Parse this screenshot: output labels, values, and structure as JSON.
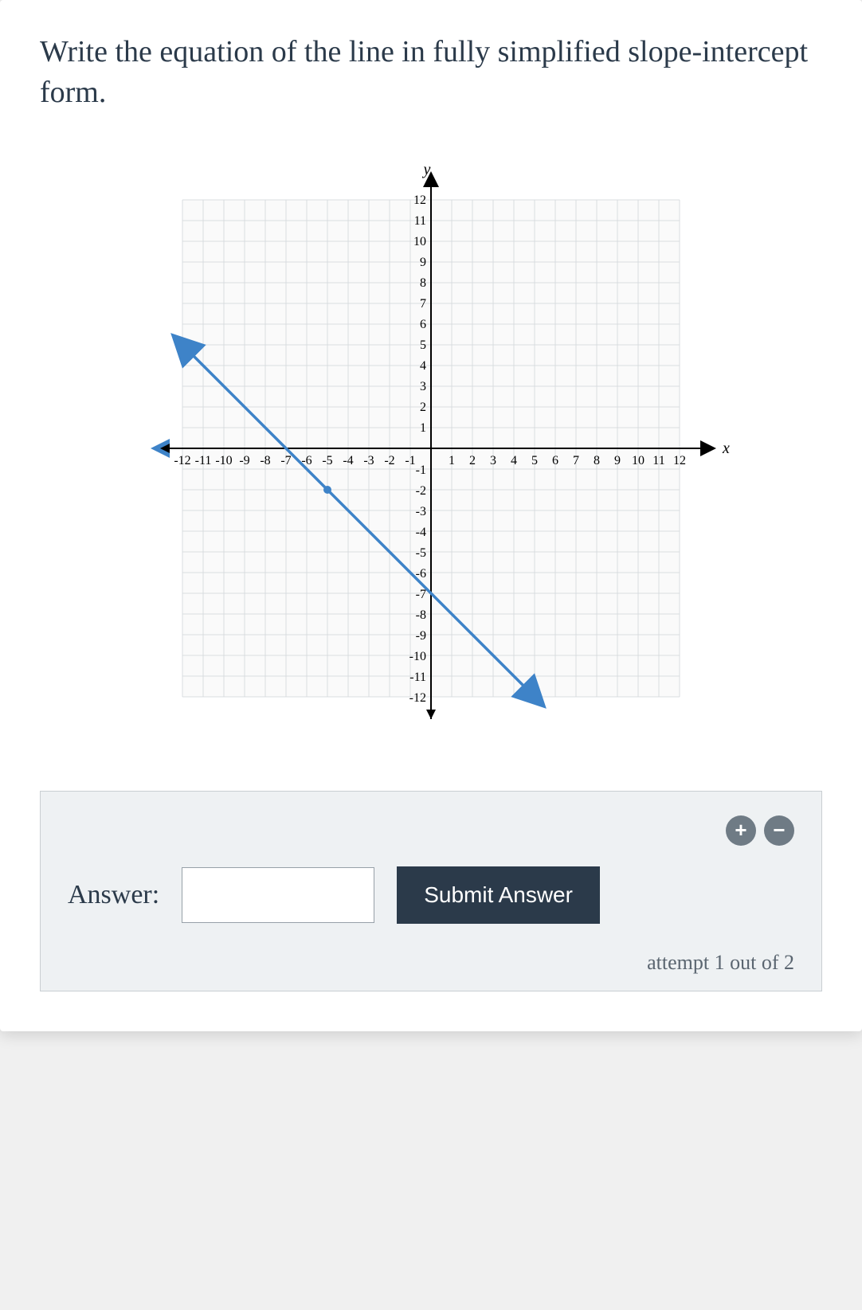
{
  "prompt": "Write the equation of the line in fully simplified slope-intercept form.",
  "chart_data": {
    "type": "line",
    "title": "",
    "xlabel": "x",
    "ylabel": "y",
    "xlim": [
      -12,
      12
    ],
    "ylim": [
      -12,
      12
    ],
    "x_ticks": [
      -12,
      -11,
      -10,
      -9,
      -8,
      -7,
      -6,
      -5,
      -4,
      -3,
      -2,
      -1,
      1,
      2,
      3,
      4,
      5,
      6,
      7,
      8,
      9,
      10,
      11,
      12
    ],
    "y_ticks": [
      12,
      11,
      10,
      9,
      8,
      7,
      6,
      5,
      4,
      3,
      2,
      1,
      -1,
      -2,
      -3,
      -4,
      -5,
      -6,
      -7,
      -8,
      -9,
      -10,
      -11,
      -12
    ],
    "series": [
      {
        "name": "line",
        "equation": "y = -x - 7",
        "slope": -1,
        "intercept": -7,
        "points": [
          [
            -12,
            5
          ],
          [
            -5,
            -2
          ],
          [
            0,
            -7
          ],
          [
            5,
            -12
          ]
        ],
        "marked_point": [
          -5,
          -2
        ],
        "color": "#3e83c8"
      }
    ],
    "grid": true
  },
  "answer": {
    "label": "Answer:",
    "value": "",
    "placeholder": ""
  },
  "buttons": {
    "submit": "Submit Answer",
    "plus": "+",
    "minus": "−"
  },
  "attempt_text": "attempt 1 out of 2"
}
